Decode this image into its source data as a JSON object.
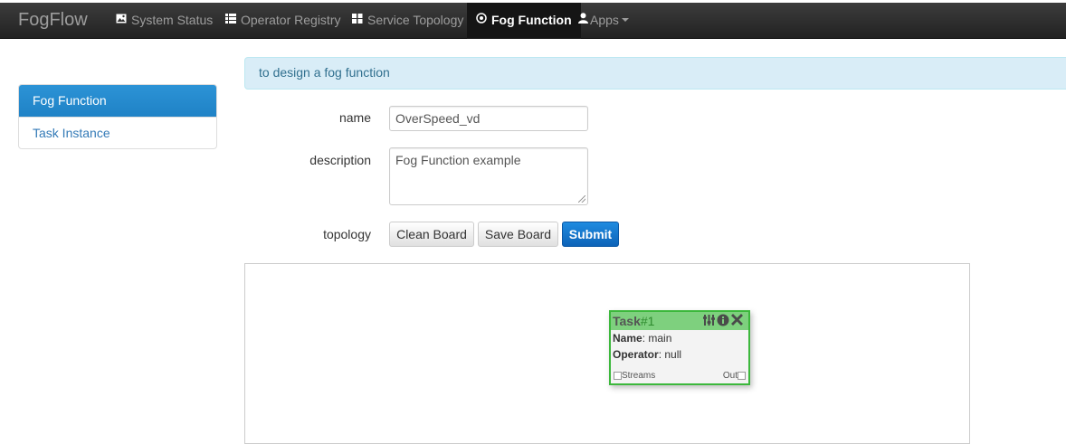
{
  "app": {
    "brand": "FogFlow"
  },
  "nav": {
    "items": [
      {
        "label": "System Status",
        "icon": "picture-icon"
      },
      {
        "label": "Operator Registry",
        "icon": "list-icon"
      },
      {
        "label": "Service Topology",
        "icon": "grid-icon"
      },
      {
        "label": "Fog Function",
        "icon": "target-icon",
        "active": true
      },
      {
        "label": "Apps",
        "icon": "user-icon",
        "dropdown": true
      }
    ]
  },
  "sidebar": {
    "items": [
      {
        "label": "Fog Function",
        "active": true
      },
      {
        "label": "Task Instance"
      }
    ]
  },
  "alert": {
    "text": "to design a fog function"
  },
  "form": {
    "name_label": "name",
    "name_value": "OverSpeed_vd",
    "description_label": "description",
    "description_value": "Fog Function example",
    "topology_label": "topology",
    "clean_label": "Clean Board",
    "save_label": "Save Board",
    "submit_label": "Submit"
  },
  "task_node": {
    "title": "Task",
    "number": "#1",
    "name_key": "Name",
    "name_value": ": main",
    "operator_key": "Operator",
    "operator_value": ": null",
    "in_port": "Streams",
    "out_port": "Out"
  },
  "colors": {
    "navbar": "#222222",
    "active_blue": "#2a8fd2",
    "submit_blue": "#0d63b8",
    "alert_bg": "#d9edf7",
    "task_green": "#7ed07e"
  }
}
